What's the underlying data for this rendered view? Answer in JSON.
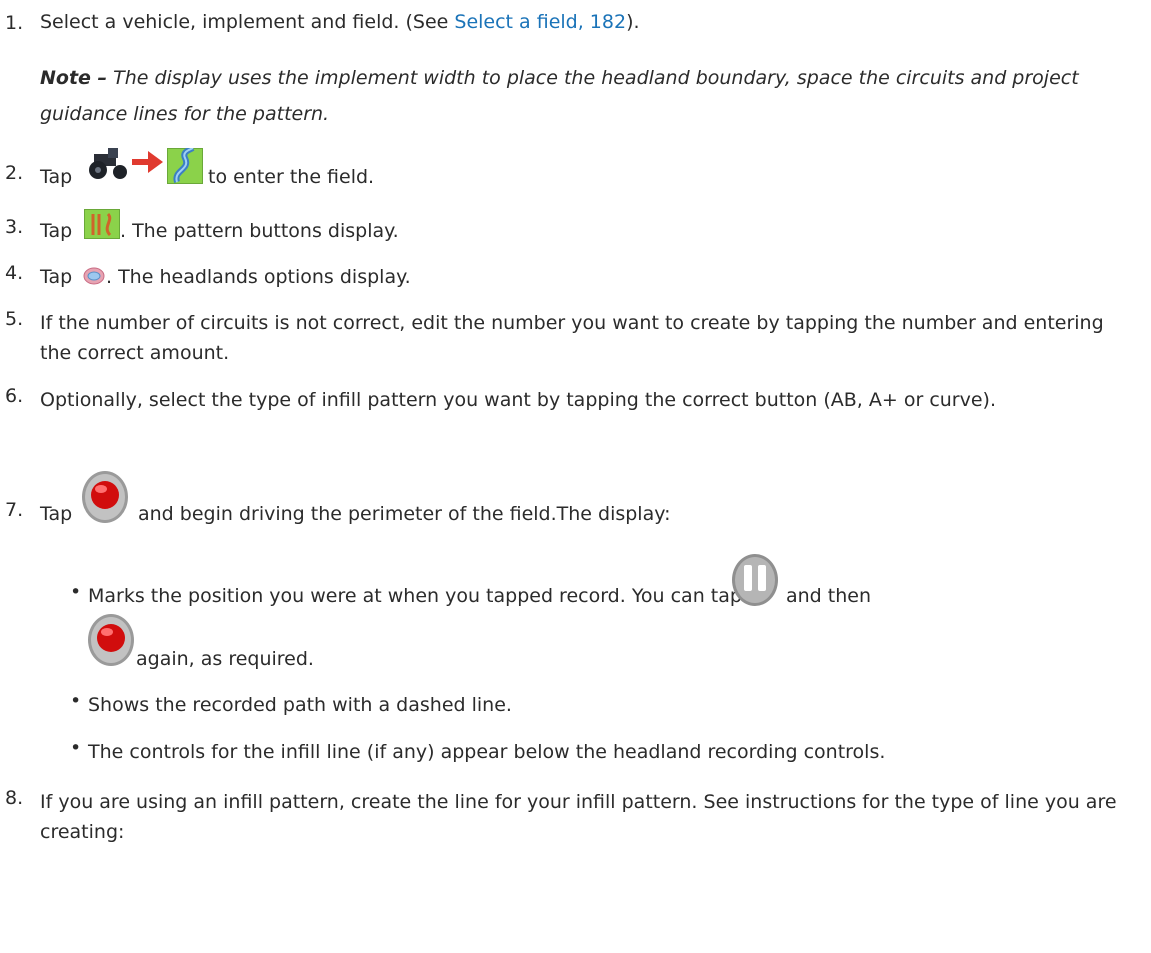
{
  "step1": {
    "num": "1.",
    "text_a": "Select a vehicle, implement and field. (See ",
    "link": "Select a field, 182",
    "text_b": ")."
  },
  "note": {
    "label": "Note –",
    "text": " The display uses the implement width to place the headland boundary, space the circuits and project guidance lines for the pattern."
  },
  "step2": {
    "num": "2.",
    "tap": "Tap",
    "text": "to enter the field."
  },
  "step3": {
    "num": "3.",
    "tap": "Tap",
    "text": ". The pattern buttons display."
  },
  "step4": {
    "num": "4.",
    "tap": "Tap",
    "text": ". The headlands options display."
  },
  "step5": {
    "num": "5.",
    "text": "If the number of circuits is not correct, edit the number you want to create by tapping the number and entering the correct amount."
  },
  "step6": {
    "num": "6.",
    "text": "Optionally, select the type of infill pattern you want by tapping the correct button (AB, A+ or curve)."
  },
  "step7": {
    "num": "7.",
    "tap": "Tap",
    "text": "and begin driving the perimeter of the field.The display:"
  },
  "bullets": {
    "b1_a": "Marks the position you were at when you tapped record. You can tap",
    "b1_b": "and then",
    "b1_c": "again, as required.",
    "b2": "Shows the recorded path with a dashed line.",
    "b3": "The controls for the infill line (if any) appear below the headland recording controls."
  },
  "step8": {
    "num": "8.",
    "text": "If you are using an infill pattern, create the line for your infill pattern. See instructions for the type of line you are creating:"
  },
  "icons": {
    "tractor": "tractor-icon",
    "arrow": "red-arrow-icon",
    "field": "field-map-icon",
    "pattern": "pattern-icon",
    "headland": "headland-icon",
    "record": "record-icon",
    "pause": "pause-icon"
  }
}
